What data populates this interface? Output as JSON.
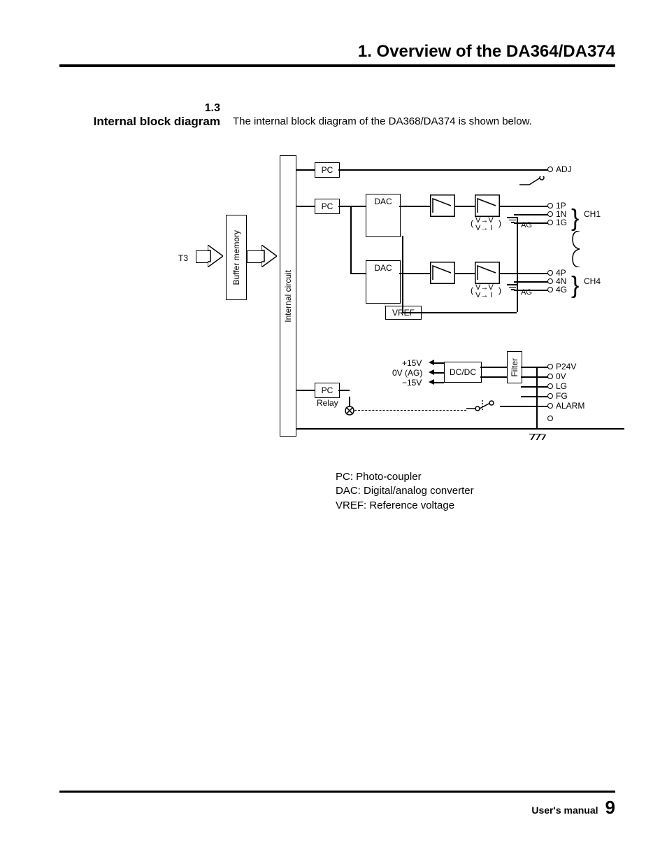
{
  "chapter_title": "1.  Overview of the DA364/DA374",
  "section": {
    "number": "1.3",
    "title": "Internal block diagram",
    "description": "The internal block diagram of the DA368/DA374 is shown below."
  },
  "diagram": {
    "input_label": "T3",
    "buffer": "Buffer memory",
    "internal": "Internal circuit",
    "pc": "PC",
    "dac": "DAC",
    "vref": "VREF",
    "relay": "Relay",
    "dcdc": "DC/DC",
    "filter": "Filter",
    "conv1": "V→V",
    "conv2": "V→ I",
    "ag": "AG",
    "power": {
      "p15": "+15V",
      "zero": "0V (AG)",
      "n15": "−15V"
    },
    "outputs": {
      "adj": "ADJ",
      "ch1": {
        "p": "1P",
        "n": "1N",
        "g": "1G",
        "label": "CH1"
      },
      "ch4": {
        "p": "4P",
        "n": "4N",
        "g": "4G",
        "label": "CH4"
      },
      "p24v": "P24V",
      "ov": "0V",
      "lg": "LG",
      "fg": "FG",
      "alarm": "ALARM"
    }
  },
  "legend": {
    "pc": "PC: Photo-coupler",
    "dac": "DAC: Digital/analog converter",
    "vref": "VREF: Reference voltage"
  },
  "footer": {
    "label": "User's manual",
    "page": "9"
  }
}
